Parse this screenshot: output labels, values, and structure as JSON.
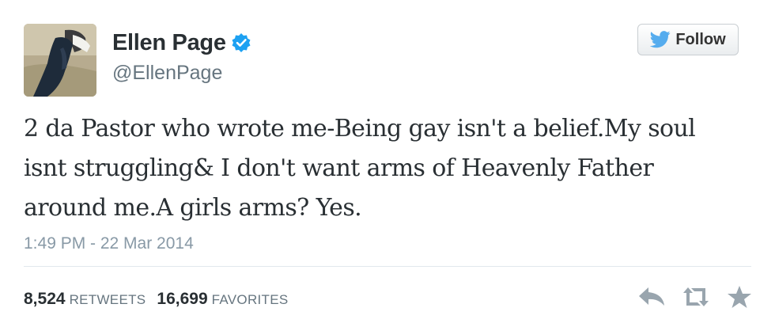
{
  "user": {
    "display_name": "Ellen Page",
    "handle": "@EllenPage",
    "verified": true
  },
  "follow_button": {
    "label": "Follow"
  },
  "tweet": {
    "text_lines": [
      "2 da Pastor who wrote me-Being gay isn't a belief.My soul",
      "isnt struggling& I don't want arms of Heavenly Father",
      "around me.A girls arms? Yes."
    ],
    "timestamp": "1:49 PM - 22 Mar 2014"
  },
  "stats": {
    "retweets_count": "8,524",
    "retweets_label": "RETWEETS",
    "favorites_count": "16,699",
    "favorites_label": "FAVORITES"
  },
  "actions": [
    "reply-icon",
    "retweet-icon",
    "favorite-icon"
  ],
  "colors": {
    "verified_blue": "#1da1f2",
    "twitter_bird": "#55acee",
    "text": "#292f33",
    "muted": "#8899a6"
  }
}
